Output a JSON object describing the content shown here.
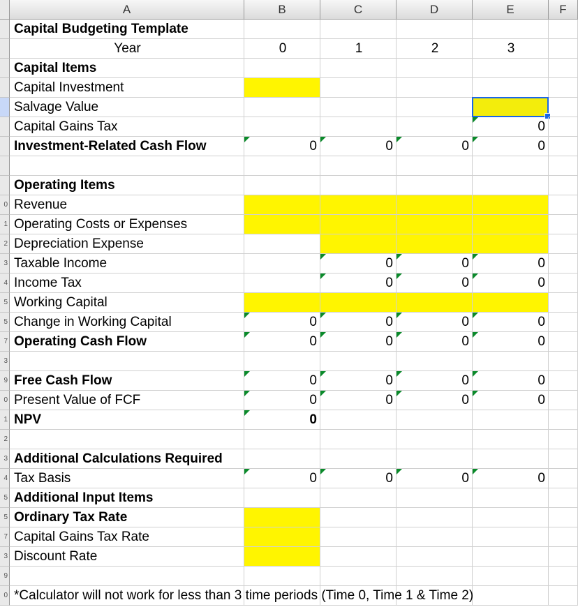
{
  "columns": [
    "A",
    "B",
    "C",
    "D",
    "E",
    "F"
  ],
  "years_label": "Year",
  "years": [
    "0",
    "1",
    "2",
    "3"
  ],
  "title": "Capital Budgeting Template",
  "sections": {
    "capital_items": "Capital Items",
    "operating_items": "Operating Items",
    "add_calc": "Additional Calculations Required",
    "add_input": "Additional Input Items"
  },
  "rows": {
    "capital_investment": "Capital Investment",
    "salvage_value": "Salvage Value",
    "capital_gains_tax": "Capital Gains Tax",
    "inv_cash_flow": "Investment-Related Cash Flow",
    "revenue": "Revenue",
    "op_costs": "Operating Costs or Expenses",
    "dep_exp": "Depreciation Expense",
    "taxable_income": "Taxable Income",
    "income_tax": "Income Tax",
    "working_capital": "Working Capital",
    "chg_wc": "Change in Working Capital",
    "op_cf": "Operating Cash Flow",
    "fcf": "Free Cash Flow",
    "pv_fcf": "Present Value of FCF",
    "npv": "NPV",
    "tax_basis": "Tax Basis",
    "ord_tax": "Ordinary Tax Rate",
    "cg_tax": "Capital Gains Tax Rate",
    "discount": "Discount Rate"
  },
  "values": {
    "capital_gains_tax": [
      "",
      "",
      "",
      "0"
    ],
    "inv_cash_flow": [
      "0",
      "0",
      "0",
      "0"
    ],
    "taxable_income": [
      "",
      "0",
      "0",
      "0"
    ],
    "income_tax": [
      "",
      "0",
      "0",
      "0"
    ],
    "chg_wc": [
      "0",
      "0",
      "0",
      "0"
    ],
    "op_cf": [
      "0",
      "0",
      "0",
      "0"
    ],
    "fcf": [
      "0",
      "0",
      "0",
      "0"
    ],
    "pv_fcf": [
      "0",
      "0",
      "0",
      "0"
    ],
    "npv": [
      "0"
    ],
    "tax_basis": [
      "0",
      "0",
      "0",
      "0"
    ]
  },
  "footer": "*Calculator will not work for less than 3 time periods (Time 0, Time 1 & Time 2)",
  "row_numbers": [
    "",
    "",
    "",
    "",
    "",
    "",
    "",
    "",
    "",
    "0",
    "1",
    "2",
    "3",
    "4",
    "5",
    "5",
    "7",
    "3",
    "9",
    "0",
    "1",
    "2",
    "3",
    "4",
    "5",
    "5",
    "7",
    "3",
    "9",
    "0"
  ]
}
